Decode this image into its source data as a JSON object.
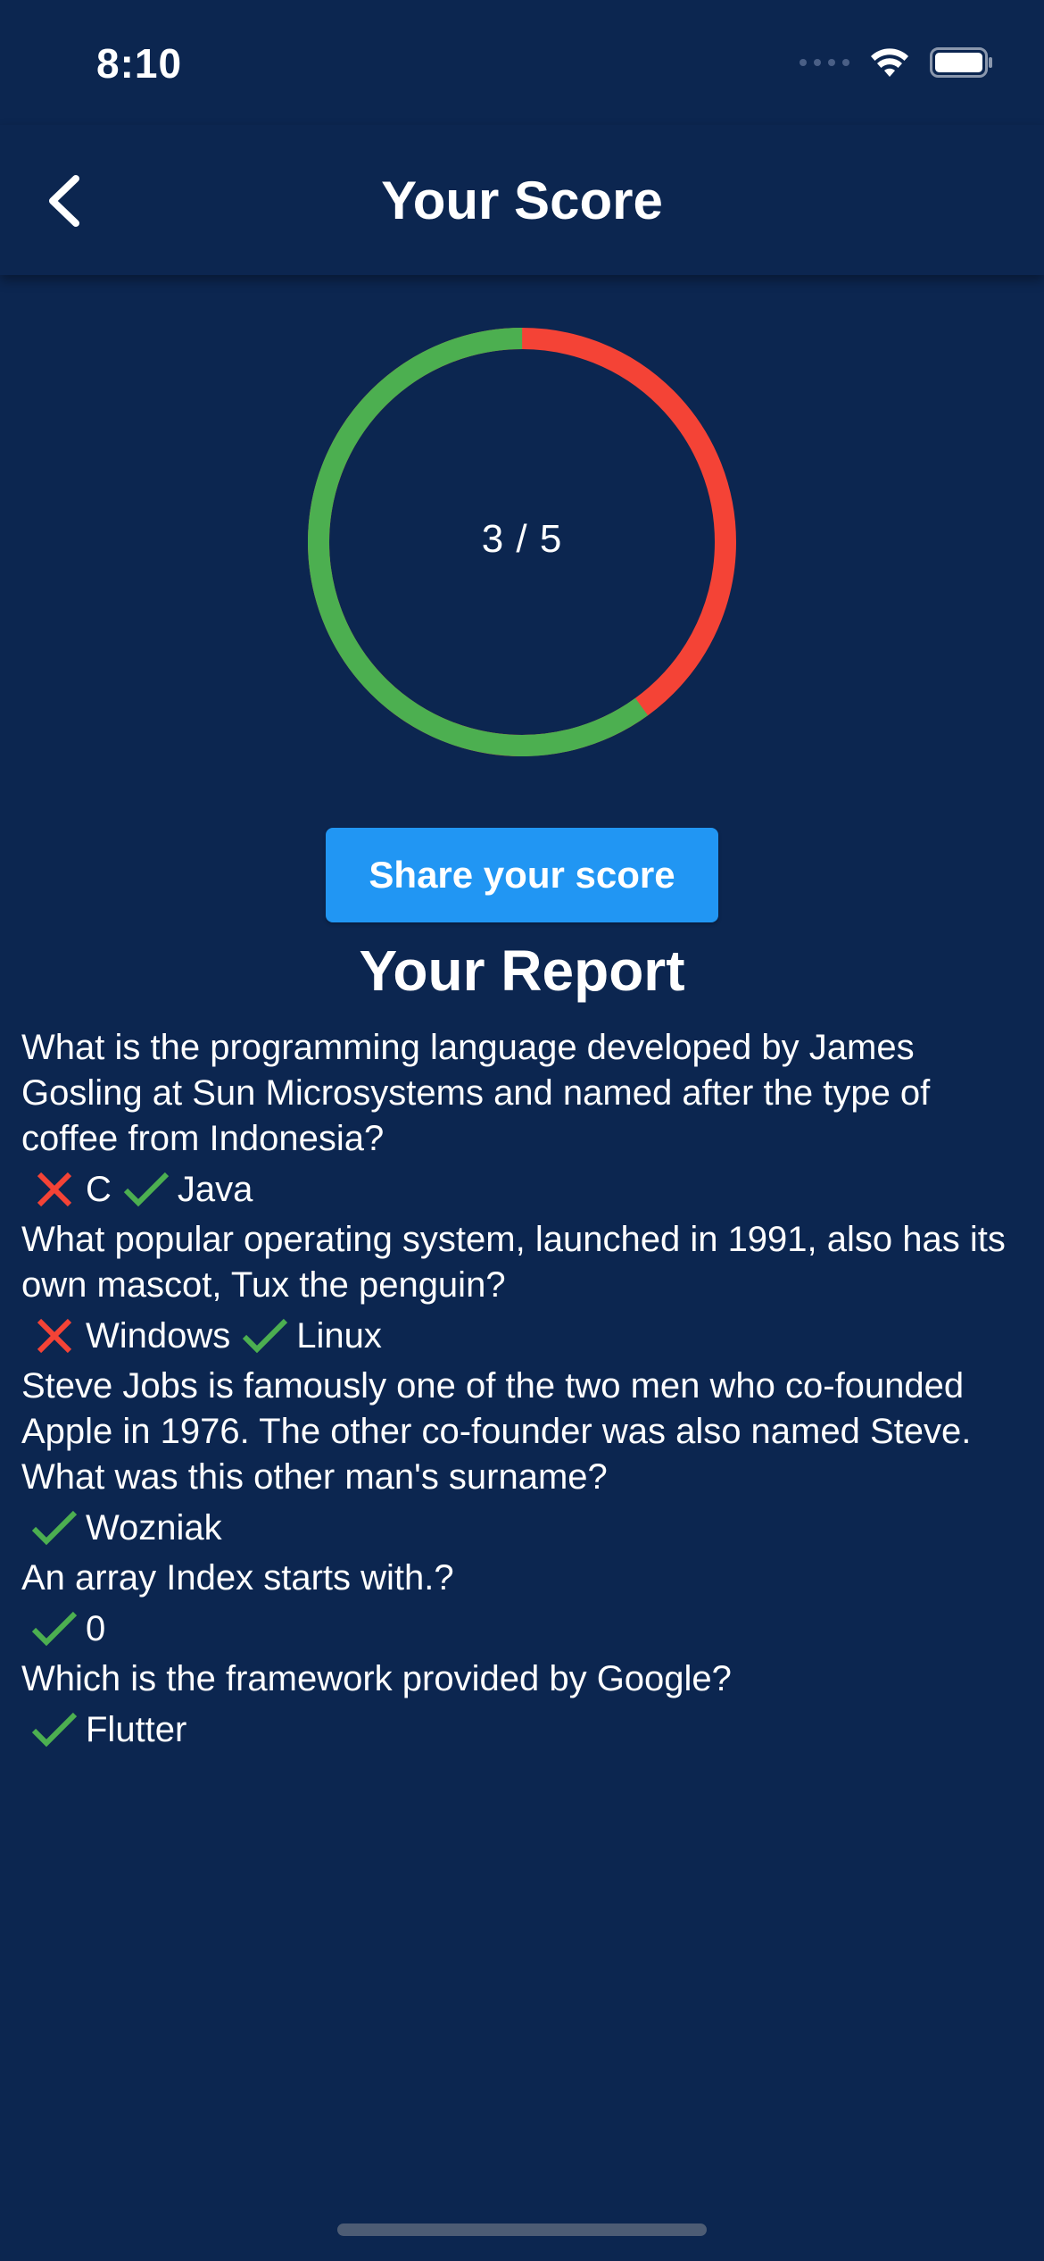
{
  "status_bar": {
    "time": "8:10"
  },
  "app_bar": {
    "title": "Your Score",
    "back_icon": "chevron-left-icon"
  },
  "score": {
    "correct": 3,
    "total": 5,
    "label": "3 / 5",
    "colors": {
      "correct": "#4caf50",
      "wrong": "#f44336"
    }
  },
  "share_button": {
    "label": "Share your score",
    "color": "#2196f3"
  },
  "report": {
    "title": "Your Report",
    "items": [
      {
        "question": "What is the programming language developed by James Gosling at Sun Microsystems and named after the type of coffee from Indonesia?",
        "answers": [
          {
            "label": "C",
            "correct": false
          },
          {
            "label": "Java",
            "correct": true
          }
        ]
      },
      {
        "question": "What popular operating system, launched in 1991, also has its own mascot, Tux the penguin?",
        "answers": [
          {
            "label": "Windows",
            "correct": false
          },
          {
            "label": "Linux",
            "correct": true
          }
        ]
      },
      {
        "question": "Steve Jobs is famously one of the two men who co-founded Apple in 1976. The other co-founder was also named Steve. What was this other man's surname?",
        "answers": [
          {
            "label": "Wozniak",
            "correct": true
          }
        ]
      },
      {
        "question": "An array Index starts with.?",
        "answers": [
          {
            "label": "0",
            "correct": true
          }
        ]
      },
      {
        "question": "Which is the framework provided by Google?",
        "answers": [
          {
            "label": "Flutter",
            "correct": true
          }
        ]
      }
    ]
  }
}
